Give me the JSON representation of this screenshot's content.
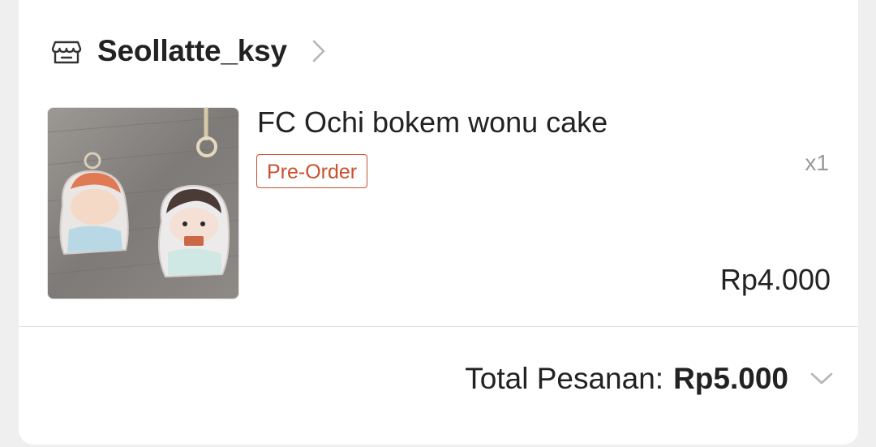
{
  "shop": {
    "name": "Seollatte_ksy",
    "icon": "store-icon"
  },
  "product": {
    "name": "FC Ochi bokem wonu cake",
    "tag": "Pre-Order",
    "quantity": "x1",
    "price": "Rp4.000",
    "thumbnail_icon": "acrylic-keychain-photo"
  },
  "order": {
    "total_label": "Total Pesanan:",
    "total_value": "Rp5.000"
  },
  "colors": {
    "accent": "#c9502e",
    "text": "#222222",
    "muted": "#9a9a9a",
    "background": "#efefef",
    "card": "#ffffff"
  }
}
